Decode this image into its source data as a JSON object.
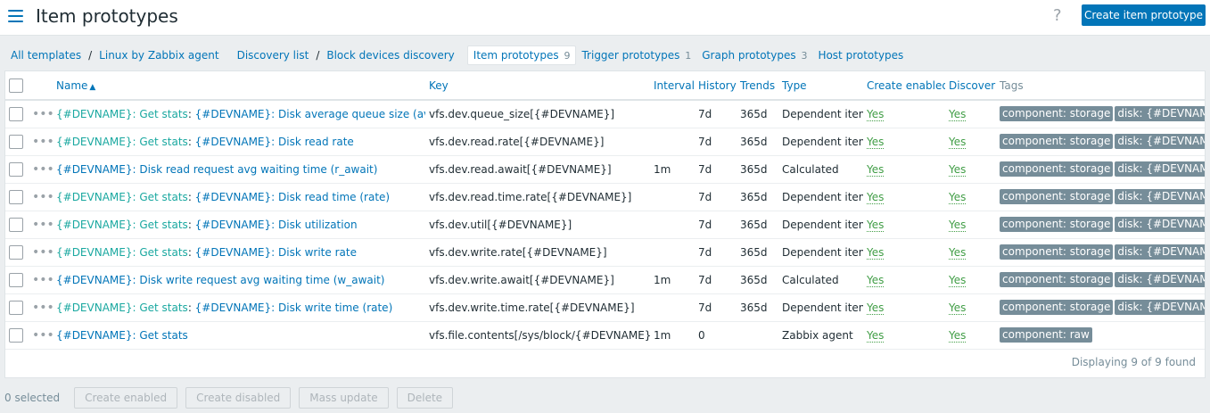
{
  "header": {
    "title": "Item prototypes",
    "help_symbol": "?",
    "create_button": "Create item prototype"
  },
  "breadcrumb": {
    "all_templates": "All templates",
    "template": "Linux by Zabbix agent",
    "discovery_list": "Discovery list",
    "discovery_rule": "Block devices discovery",
    "separator": "/",
    "tabs": [
      {
        "label": "Item prototypes",
        "count": "9",
        "active": true
      },
      {
        "label": "Trigger prototypes",
        "count": "1",
        "active": false
      },
      {
        "label": "Graph prototypes",
        "count": "3",
        "active": false
      },
      {
        "label": "Host prototypes",
        "count": "",
        "active": false
      }
    ]
  },
  "table": {
    "columns": {
      "name": "Name",
      "key": "Key",
      "interval": "Interval",
      "history": "History",
      "trends": "Trends",
      "type": "Type",
      "create_enabled": "Create enabled",
      "discover": "Discover",
      "tags": "Tags"
    },
    "sort_indicator": "▲",
    "rows": [
      {
        "parent": "{#DEVNAME}: Get stats",
        "sep": ": ",
        "name": "{#DEVNAME}: Disk average queue size (avgqu-sz)",
        "key": "vfs.dev.queue_size[{#DEVNAME}]",
        "interval": "",
        "history": "7d",
        "trends": "365d",
        "type": "Dependent item",
        "create_enabled": "Yes",
        "discover": "Yes",
        "tags": [
          "component: storage",
          "disk: {#DEVNAME}"
        ]
      },
      {
        "parent": "{#DEVNAME}: Get stats",
        "sep": ": ",
        "name": "{#DEVNAME}: Disk read rate",
        "key": "vfs.dev.read.rate[{#DEVNAME}]",
        "interval": "",
        "history": "7d",
        "trends": "365d",
        "type": "Dependent item",
        "create_enabled": "Yes",
        "discover": "Yes",
        "tags": [
          "component: storage",
          "disk: {#DEVNAME}"
        ]
      },
      {
        "parent": "",
        "sep": "",
        "name": "{#DEVNAME}: Disk read request avg waiting time (r_await)",
        "key": "vfs.dev.read.await[{#DEVNAME}]",
        "interval": "1m",
        "history": "7d",
        "trends": "365d",
        "type": "Calculated",
        "create_enabled": "Yes",
        "discover": "Yes",
        "tags": [
          "component: storage",
          "disk: {#DEVNAME}"
        ]
      },
      {
        "parent": "{#DEVNAME}: Get stats",
        "sep": ": ",
        "name": "{#DEVNAME}: Disk read time (rate)",
        "key": "vfs.dev.read.time.rate[{#DEVNAME}]",
        "interval": "",
        "history": "7d",
        "trends": "365d",
        "type": "Dependent item",
        "create_enabled": "Yes",
        "discover": "Yes",
        "tags": [
          "component: storage",
          "disk: {#DEVNAME}"
        ]
      },
      {
        "parent": "{#DEVNAME}: Get stats",
        "sep": ": ",
        "name": "{#DEVNAME}: Disk utilization",
        "key": "vfs.dev.util[{#DEVNAME}]",
        "interval": "",
        "history": "7d",
        "trends": "365d",
        "type": "Dependent item",
        "create_enabled": "Yes",
        "discover": "Yes",
        "tags": [
          "component: storage",
          "disk: {#DEVNAME}"
        ]
      },
      {
        "parent": "{#DEVNAME}: Get stats",
        "sep": ": ",
        "name": "{#DEVNAME}: Disk write rate",
        "key": "vfs.dev.write.rate[{#DEVNAME}]",
        "interval": "",
        "history": "7d",
        "trends": "365d",
        "type": "Dependent item",
        "create_enabled": "Yes",
        "discover": "Yes",
        "tags": [
          "component: storage",
          "disk: {#DEVNAME}"
        ]
      },
      {
        "parent": "",
        "sep": "",
        "name": "{#DEVNAME}: Disk write request avg waiting time (w_await)",
        "key": "vfs.dev.write.await[{#DEVNAME}]",
        "interval": "1m",
        "history": "7d",
        "trends": "365d",
        "type": "Calculated",
        "create_enabled": "Yes",
        "discover": "Yes",
        "tags": [
          "component: storage",
          "disk: {#DEVNAME}"
        ]
      },
      {
        "parent": "{#DEVNAME}: Get stats",
        "sep": ": ",
        "name": "{#DEVNAME}: Disk write time (rate)",
        "key": "vfs.dev.write.time.rate[{#DEVNAME}]",
        "interval": "",
        "history": "7d",
        "trends": "365d",
        "type": "Dependent item",
        "create_enabled": "Yes",
        "discover": "Yes",
        "tags": [
          "component: storage",
          "disk: {#DEVNAME}"
        ]
      },
      {
        "parent": "",
        "sep": "",
        "name": "{#DEVNAME}: Get stats",
        "key": "vfs.file.contents[/sys/block/{#DEVNAME}/stat]",
        "interval": "1m",
        "history": "0",
        "trends": "",
        "type": "Zabbix agent",
        "create_enabled": "Yes",
        "discover": "Yes",
        "tags": [
          "component: raw"
        ]
      }
    ],
    "footer": "Displaying 9 of 9 found"
  },
  "actions": {
    "selected": "0 selected",
    "buttons": [
      "Create enabled",
      "Create disabled",
      "Mass update",
      "Delete"
    ]
  },
  "colors": {
    "link": "#0275b8",
    "parent_link": "#1aa8a0",
    "yes": "#429e47",
    "tag_bg": "#768d99",
    "primary_button": "#0275b8"
  }
}
